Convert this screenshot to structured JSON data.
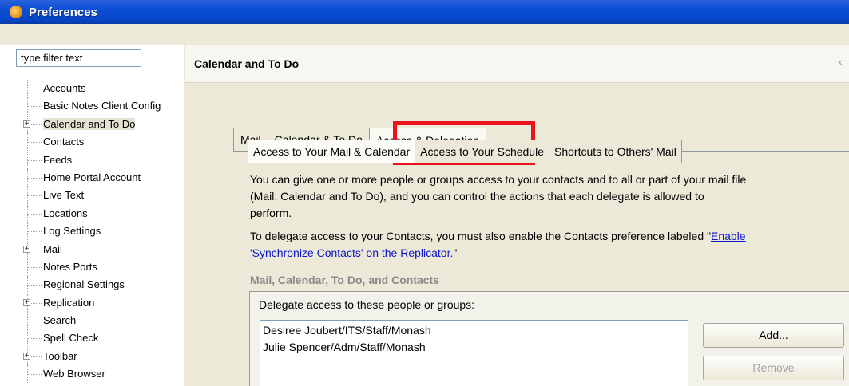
{
  "window": {
    "title": "Preferences"
  },
  "filter": {
    "value": "type filter text"
  },
  "tree": [
    {
      "label": "Accounts",
      "expandable": false
    },
    {
      "label": "Basic Notes Client Config",
      "expandable": false
    },
    {
      "label": "Calendar and To Do",
      "expandable": true,
      "selected": true
    },
    {
      "label": "Contacts",
      "expandable": false
    },
    {
      "label": "Feeds",
      "expandable": false
    },
    {
      "label": "Home Portal Account",
      "expandable": false
    },
    {
      "label": "Live Text",
      "expandable": false
    },
    {
      "label": "Locations",
      "expandable": false
    },
    {
      "label": "Log Settings",
      "expandable": false
    },
    {
      "label": "Mail",
      "expandable": true
    },
    {
      "label": "Notes Ports",
      "expandable": false
    },
    {
      "label": "Regional Settings",
      "expandable": false
    },
    {
      "label": "Replication",
      "expandable": true
    },
    {
      "label": "Search",
      "expandable": false
    },
    {
      "label": "Spell Check",
      "expandable": false
    },
    {
      "label": "Toolbar",
      "expandable": true
    },
    {
      "label": "Web Browser",
      "expandable": false
    }
  ],
  "page": {
    "title": "Calendar and To Do"
  },
  "tabs": [
    {
      "label": "Mail"
    },
    {
      "label": "Calendar & To Do"
    },
    {
      "label": "Access & Delegation",
      "active": true
    }
  ],
  "subtabs": [
    {
      "label": "Access to Your Mail & Calendar",
      "active": true
    },
    {
      "label": "Access to Your Schedule"
    },
    {
      "label": "Shortcuts to Others' Mail"
    }
  ],
  "description": {
    "line1": "You can give one or more people or groups access to your contacts and to all or part of your mail file",
    "line2": "(Mail, Calendar and To Do), and you can control the actions that each delegate is allowed to",
    "line3": "perform."
  },
  "contacts_note": {
    "text": "To delegate access to your Contacts, you must also enable the Contacts preference labeled \"",
    "link_part1": "Enable",
    "link_part2": "'Synchronize Contacts' on the Replicator.",
    "suffix": "\""
  },
  "group": {
    "title": "Mail, Calendar, To Do, and Contacts",
    "delegate_label": "Delegate access to these people or groups:",
    "delegates": [
      "Desiree Joubert/ITS/Staff/Monash",
      "Julie Spencer/Adm/Staff/Monash"
    ],
    "add_label": "Add...",
    "remove_label": "Remove"
  }
}
